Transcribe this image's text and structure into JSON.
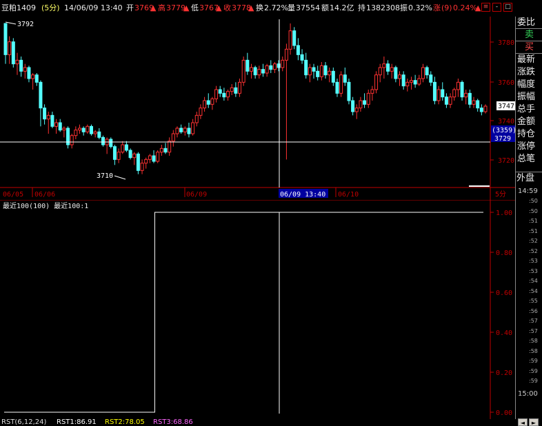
{
  "header": {
    "symbol": "豆粕1409",
    "period": "(5分)",
    "datetime": "14/06/09 13:40",
    "open_label": "开",
    "open_value": "3769",
    "high_label": "高",
    "high_value": "3779",
    "low_label": "低",
    "low_value": "3767",
    "close_label": "收",
    "close_value": "3778",
    "turnover_label": "换",
    "turnover_value": "2.72%",
    "volume_label": "量",
    "volume_value": "37554",
    "amount_label": "额",
    "amount_value": "14.2亿",
    "position_label": "持",
    "position_value": "1382308",
    "amplitude_label": "振",
    "amplitude_value": "0.32%",
    "change_label": "涨",
    "change_value": "(9)",
    "change_pct": "0.24%"
  },
  "window_controls": {
    "settings": "≡",
    "minimize": "-",
    "maximize": "□"
  },
  "right_panel": {
    "items": [
      "委比",
      "卖",
      "买",
      "最新",
      "涨跌",
      "幅度",
      "振幅",
      "总手",
      "金额",
      "持仓",
      "涨停",
      "总笔",
      "外盘"
    ]
  },
  "price_axis": {
    "labels": [
      "3780",
      "3760",
      "3740",
      "3720"
    ],
    "last_price": "3747",
    "cursor_count": "(3359)",
    "cursor_price": "3729"
  },
  "annotations": {
    "high_marker": "3792",
    "low_marker": "3710"
  },
  "date_axis": {
    "labels": [
      "06/05",
      "06/06",
      "06/09",
      "06/09 13:40",
      "06/10"
    ],
    "period": "5分"
  },
  "indicator": {
    "title": "最近100(100) 最近100:1",
    "axis_labels": [
      "1.00",
      "0.80",
      "0.60",
      "0.40",
      "0.20",
      "0.00"
    ]
  },
  "time_panel": {
    "start": "14:59",
    "end": "15:00",
    "minutes": [
      ":50",
      ":50",
      ":51",
      ":51",
      ":52",
      ":52",
      ":53",
      ":53",
      ":54",
      ":54",
      ":55",
      ":56",
      ":57",
      ":57",
      ":58",
      ":58",
      ":59",
      ":59",
      ":59"
    ]
  },
  "bottom_bar": {
    "label": "RST(6,12,24)",
    "rst1": "RST1:86.91",
    "rst2": "RST2:78.05",
    "rst3": "RST3:68.86"
  },
  "colors": {
    "up": "#ff3232",
    "down": "#54ffff",
    "axis": "#c00000",
    "cursor": "#ffffff",
    "highlight_bg": "#0000a0",
    "indicator_line": "#ffffff",
    "rst3": "#ff66ff",
    "rst2": "#ffff00"
  },
  "chart_data": [
    {
      "type": "candlestick",
      "title": "",
      "ylim": [
        3705,
        3795
      ],
      "candles": [
        [
          3792,
          3792,
          3770,
          3775
        ],
        [
          3775,
          3785,
          3770,
          3782
        ],
        [
          3782,
          3784,
          3768,
          3770
        ],
        [
          3770,
          3776,
          3764,
          3772
        ],
        [
          3772,
          3774,
          3763,
          3766
        ],
        [
          3766,
          3770,
          3762,
          3768
        ],
        [
          3768,
          3769,
          3760,
          3762
        ],
        [
          3762,
          3765,
          3756,
          3764
        ],
        [
          3764,
          3765,
          3758,
          3760
        ],
        [
          3760,
          3761,
          3736,
          3746
        ],
        [
          3746,
          3748,
          3737,
          3740
        ],
        [
          3740,
          3744,
          3732,
          3742
        ],
        [
          3742,
          3744,
          3735,
          3736
        ],
        [
          3736,
          3740,
          3732,
          3738
        ],
        [
          3738,
          3740,
          3733,
          3734
        ],
        [
          3734,
          3736,
          3730,
          3735
        ],
        [
          3735,
          3736,
          3724,
          3726
        ],
        [
          3726,
          3732,
          3724,
          3731
        ],
        [
          3731,
          3736,
          3729,
          3734
        ],
        [
          3734,
          3737,
          3732,
          3735
        ],
        [
          3735,
          3736,
          3731,
          3733
        ],
        [
          3733,
          3737,
          3732,
          3736
        ],
        [
          3736,
          3737,
          3731,
          3732
        ],
        [
          3732,
          3734,
          3730,
          3733
        ],
        [
          3733,
          3735,
          3729,
          3730
        ],
        [
          3730,
          3731,
          3725,
          3726
        ],
        [
          3726,
          3730,
          3721,
          3729
        ],
        [
          3729,
          3730,
          3724,
          3725
        ],
        [
          3725,
          3726,
          3715,
          3718
        ],
        [
          3718,
          3724,
          3716,
          3722
        ],
        [
          3722,
          3728,
          3721,
          3726
        ],
        [
          3726,
          3728,
          3722,
          3723
        ],
        [
          3723,
          3724,
          3718,
          3719
        ],
        [
          3719,
          3722,
          3715,
          3721
        ],
        [
          3721,
          3722,
          3710,
          3712
        ],
        [
          3712,
          3718,
          3710,
          3716
        ],
        [
          3716,
          3719,
          3713,
          3718
        ],
        [
          3718,
          3721,
          3716,
          3720
        ],
        [
          3720,
          3723,
          3716,
          3717
        ],
        [
          3717,
          3723,
          3716,
          3722
        ],
        [
          3722,
          3726,
          3720,
          3724
        ],
        [
          3724,
          3727,
          3721,
          3722
        ],
        [
          3722,
          3730,
          3720,
          3728
        ],
        [
          3728,
          3734,
          3725,
          3732
        ],
        [
          3732,
          3736,
          3730,
          3735
        ],
        [
          3735,
          3737,
          3732,
          3733
        ],
        [
          3733,
          3736,
          3731,
          3735
        ],
        [
          3735,
          3738,
          3730,
          3732
        ],
        [
          3732,
          3740,
          3731,
          3738
        ],
        [
          3738,
          3744,
          3736,
          3742
        ],
        [
          3742,
          3748,
          3740,
          3746
        ],
        [
          3746,
          3752,
          3744,
          3750
        ],
        [
          3750,
          3754,
          3746,
          3748
        ],
        [
          3748,
          3752,
          3745,
          3751
        ],
        [
          3751,
          3758,
          3749,
          3756
        ],
        [
          3756,
          3758,
          3752,
          3754
        ],
        [
          3754,
          3757,
          3750,
          3752
        ],
        [
          3752,
          3756,
          3750,
          3755
        ],
        [
          3755,
          3759,
          3753,
          3757
        ],
        [
          3757,
          3760,
          3752,
          3754
        ],
        [
          3754,
          3762,
          3752,
          3760
        ],
        [
          3760,
          3774,
          3758,
          3772
        ],
        [
          3772,
          3776,
          3764,
          3766
        ],
        [
          3766,
          3770,
          3762,
          3768
        ],
        [
          3768,
          3769,
          3762,
          3764
        ],
        [
          3764,
          3769,
          3762,
          3767
        ],
        [
          3767,
          3770,
          3763,
          3765
        ],
        [
          3765,
          3770,
          3763,
          3769
        ],
        [
          3769,
          3772,
          3765,
          3767
        ],
        [
          3767,
          3771,
          3765,
          3770
        ],
        [
          3770,
          3772,
          3766,
          3768
        ],
        [
          3768,
          3774,
          3766,
          3772
        ],
        [
          3772,
          3781,
          3718,
          3778
        ],
        [
          3778,
          3792,
          3775,
          3788
        ],
        [
          3788,
          3790,
          3778,
          3780
        ],
        [
          3780,
          3784,
          3772,
          3775
        ],
        [
          3775,
          3778,
          3770,
          3772
        ],
        [
          3772,
          3776,
          3762,
          3764
        ],
        [
          3764,
          3770,
          3760,
          3768
        ],
        [
          3768,
          3770,
          3762,
          3766
        ],
        [
          3766,
          3769,
          3761,
          3763
        ],
        [
          3763,
          3771,
          3761,
          3769
        ],
        [
          3769,
          3771,
          3762,
          3764
        ],
        [
          3764,
          3768,
          3760,
          3766
        ],
        [
          3766,
          3768,
          3758,
          3760
        ],
        [
          3760,
          3762,
          3752,
          3754
        ],
        [
          3754,
          3766,
          3752,
          3764
        ],
        [
          3764,
          3768,
          3758,
          3760
        ],
        [
          3760,
          3762,
          3748,
          3750
        ],
        [
          3750,
          3752,
          3742,
          3744
        ],
        [
          3744,
          3748,
          3740,
          3746
        ],
        [
          3746,
          3752,
          3744,
          3750
        ],
        [
          3750,
          3754,
          3746,
          3748
        ],
        [
          3748,
          3756,
          3746,
          3754
        ],
        [
          3754,
          3758,
          3750,
          3756
        ],
        [
          3756,
          3766,
          3754,
          3764
        ],
        [
          3764,
          3770,
          3760,
          3768
        ],
        [
          3768,
          3774,
          3762,
          3770
        ],
        [
          3770,
          3772,
          3764,
          3766
        ],
        [
          3766,
          3770,
          3762,
          3768
        ],
        [
          3768,
          3769,
          3760,
          3762
        ],
        [
          3762,
          3766,
          3758,
          3764
        ],
        [
          3764,
          3766,
          3756,
          3758
        ],
        [
          3758,
          3762,
          3755,
          3760
        ],
        [
          3760,
          3763,
          3756,
          3761
        ],
        [
          3761,
          3764,
          3757,
          3759
        ],
        [
          3759,
          3764,
          3758,
          3762
        ],
        [
          3762,
          3770,
          3760,
          3768
        ],
        [
          3768,
          3769,
          3762,
          3764
        ],
        [
          3764,
          3766,
          3758,
          3760
        ],
        [
          3760,
          3763,
          3748,
          3750
        ],
        [
          3750,
          3758,
          3748,
          3756
        ],
        [
          3756,
          3760,
          3750,
          3752
        ],
        [
          3752,
          3754,
          3746,
          3748
        ],
        [
          3748,
          3754,
          3746,
          3752
        ],
        [
          3752,
          3757,
          3750,
          3756
        ],
        [
          3756,
          3762,
          3752,
          3760
        ],
        [
          3760,
          3761,
          3750,
          3752
        ],
        [
          3752,
          3756,
          3748,
          3754
        ],
        [
          3754,
          3756,
          3746,
          3748
        ],
        [
          3748,
          3752,
          3746,
          3750
        ],
        [
          3750,
          3751,
          3744,
          3746
        ],
        [
          3746,
          3748,
          3742,
          3744
        ],
        [
          3744,
          3748,
          3743,
          3747
        ]
      ]
    },
    {
      "type": "line",
      "title": "最近100(100) 最近100:1",
      "ylim": [
        0,
        1
      ],
      "series": [
        {
          "name": "最近100",
          "values": [
            0,
            0,
            0,
            0,
            0,
            0,
            0,
            0,
            0,
            0,
            0,
            0,
            0,
            0,
            0,
            0,
            0,
            0,
            0,
            0,
            0,
            0,
            0,
            0,
            0,
            0,
            0,
            0,
            0,
            0,
            0,
            0,
            0,
            0,
            0,
            0,
            0,
            0,
            0,
            0,
            0,
            0,
            0,
            0,
            0,
            0,
            0,
            0,
            0,
            0,
            0,
            0,
            0,
            0,
            0,
            1,
            1,
            1,
            1,
            1,
            1,
            1,
            1,
            1,
            1,
            1,
            1,
            1,
            1,
            1,
            1,
            1,
            1,
            1,
            1,
            1,
            1,
            1,
            1,
            1,
            1,
            1,
            1,
            1,
            1,
            1,
            1,
            1,
            1,
            1,
            1,
            1,
            1,
            1,
            1,
            1,
            1,
            1,
            1,
            1,
            1,
            1,
            1,
            1,
            1,
            1,
            1,
            1,
            1,
            1,
            1,
            1,
            1,
            1,
            1,
            1,
            1,
            1,
            1,
            1,
            1,
            1,
            1,
            1,
            1,
            1,
            1,
            1,
            1,
            1,
            1,
            1,
            1,
            1,
            1,
            1,
            1,
            1,
            1,
            1,
            1,
            1,
            1,
            1,
            1,
            1,
            1,
            1,
            1,
            1,
            1,
            1,
            1,
            1,
            1,
            1,
            1,
            1,
            1,
            1,
            1,
            1,
            1,
            1,
            1,
            1,
            1,
            1,
            1,
            1,
            1,
            1,
            1,
            1,
            1,
            1
          ]
        }
      ]
    }
  ]
}
